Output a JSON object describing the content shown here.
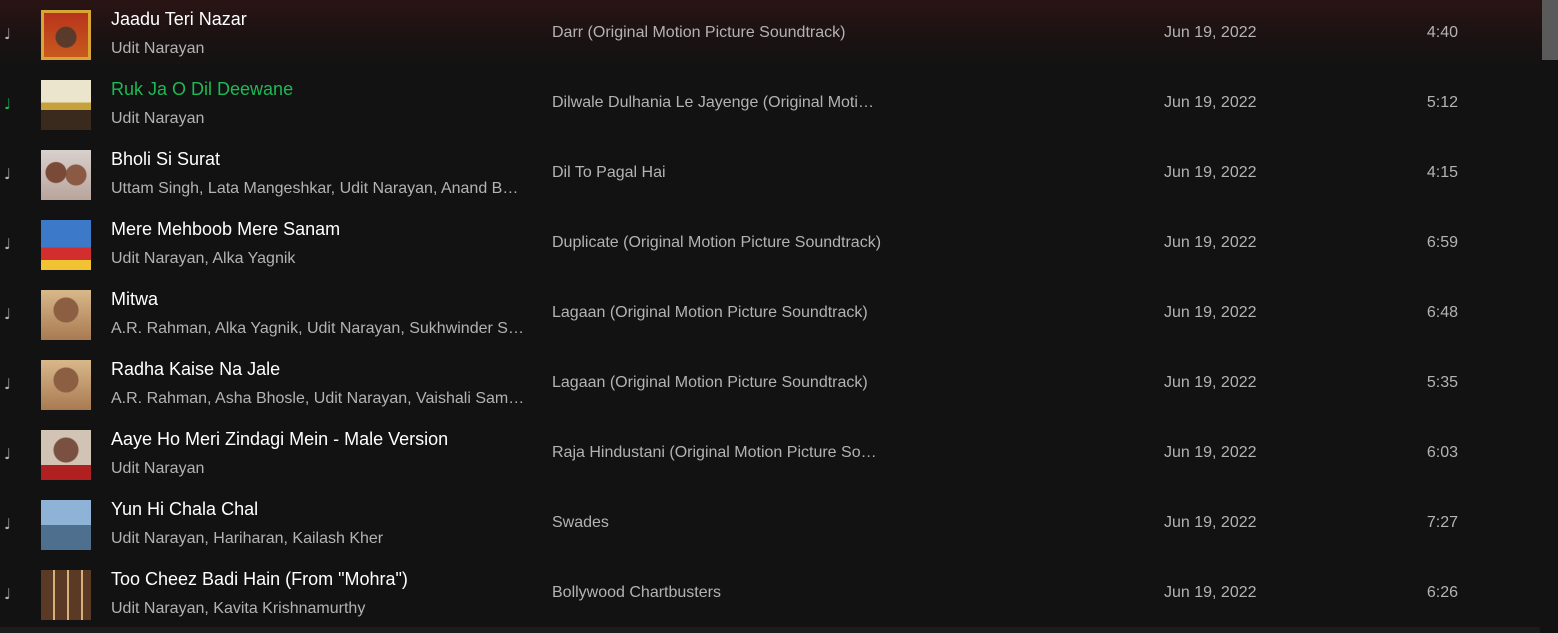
{
  "tracks": [
    {
      "title": "Jaadu Teri Nazar",
      "artists": "Udit Narayan",
      "album": "Darr (Original Motion Picture Soundtrack)",
      "date_added": "Jun 19, 2022",
      "duration": "4:40",
      "active": false,
      "icon": "music-note-icon"
    },
    {
      "title": "Ruk Ja O Dil Deewane",
      "artists": "Udit Narayan",
      "album": "Dilwale Dulhania Le Jayenge (Original Motion Picture Soundtrack)",
      "date_added": "Jun 19, 2022",
      "duration": "5:12",
      "active": true,
      "icon": "music-note-icon"
    },
    {
      "title": "Bholi Si Surat",
      "artists": "Uttam Singh, Lata Mangeshkar, Udit Narayan, Anand Bakshi",
      "album": "Dil To Pagal Hai",
      "date_added": "Jun 19, 2022",
      "duration": "4:15",
      "active": false,
      "icon": "music-note-icon"
    },
    {
      "title": "Mere Mehboob Mere Sanam",
      "artists": "Udit Narayan, Alka Yagnik",
      "album": "Duplicate (Original Motion Picture Soundtrack)",
      "date_added": "Jun 19, 2022",
      "duration": "6:59",
      "active": false,
      "icon": "music-note-icon"
    },
    {
      "title": "Mitwa",
      "artists": "A.R. Rahman, Alka Yagnik, Udit Narayan, Sukhwinder Singh",
      "album": "Lagaan (Original Motion Picture Soundtrack)",
      "date_added": "Jun 19, 2022",
      "duration": "6:48",
      "active": false,
      "icon": "music-note-icon"
    },
    {
      "title": "Radha Kaise Na Jale",
      "artists": "A.R. Rahman, Asha Bhosle, Udit Narayan, Vaishali Samant",
      "album": "Lagaan (Original Motion Picture Soundtrack)",
      "date_added": "Jun 19, 2022",
      "duration": "5:35",
      "active": false,
      "icon": "music-note-icon"
    },
    {
      "title": "Aaye Ho Meri Zindagi Mein - Male Version",
      "artists": "Udit Narayan",
      "album": "Raja Hindustani (Original Motion Picture Soundtrack)",
      "date_added": "Jun 19, 2022",
      "duration": "6:03",
      "active": false,
      "icon": "music-note-icon"
    },
    {
      "title": "Yun Hi Chala Chal",
      "artists": "Udit Narayan, Hariharan, Kailash Kher",
      "album": "Swades",
      "date_added": "Jun 19, 2022",
      "duration": "7:27",
      "active": false,
      "icon": "music-note-icon"
    },
    {
      "title": "Too Cheez Badi Hain (From \"Mohra\")",
      "artists": "Udit Narayan, Kavita Krishnamurthy",
      "album": "Bollywood Chartbusters",
      "date_added": "Jun 19, 2022",
      "duration": "6:26",
      "active": false,
      "icon": "music-note-icon"
    }
  ],
  "colors": {
    "background": "#121212",
    "primary_text": "#ffffff",
    "secondary_text": "#b3b3b3",
    "accent": "#1db954"
  }
}
